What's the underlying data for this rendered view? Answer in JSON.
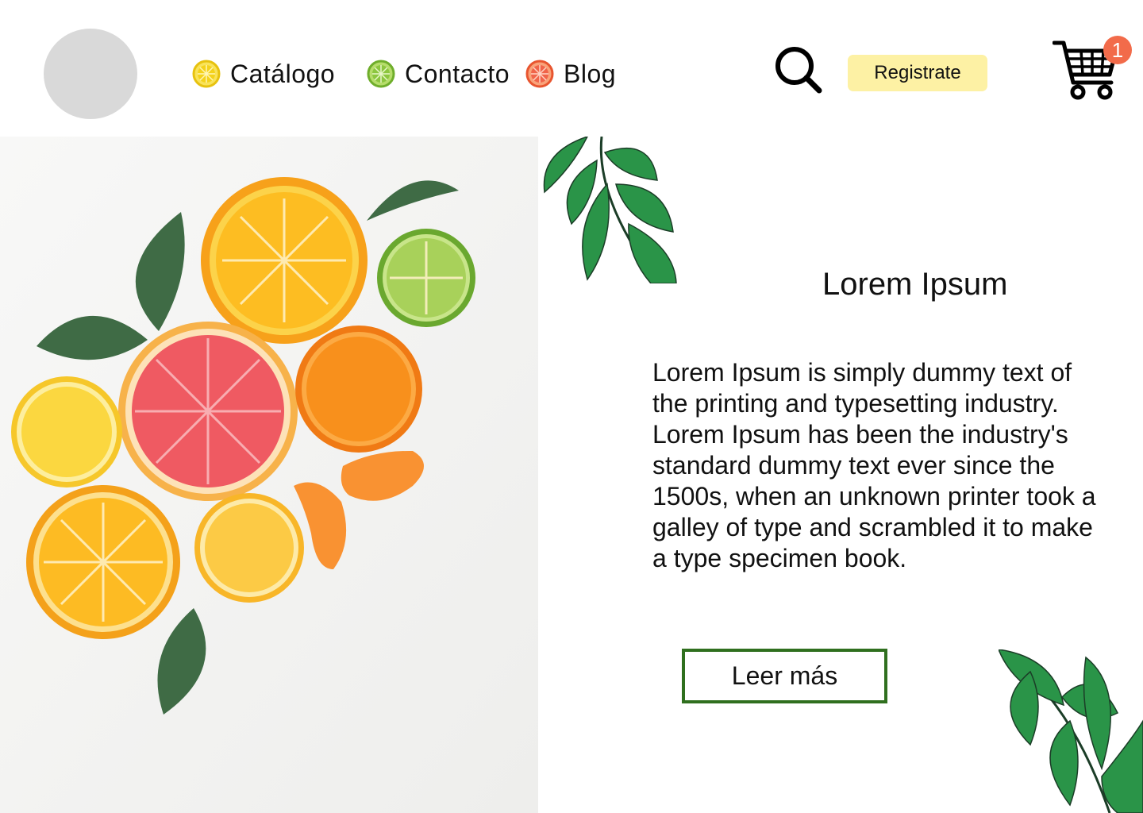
{
  "header": {
    "nav": [
      {
        "label": "Catálogo",
        "icon": "lemon-slice-icon",
        "color": "#f4d21c"
      },
      {
        "label": "Contacto",
        "icon": "lime-slice-icon",
        "color": "#8cc63f"
      },
      {
        "label": "Blog",
        "icon": "grapefruit-slice-icon",
        "color": "#f0644a"
      }
    ],
    "search_icon": "search-icon",
    "register_label": "Registrate",
    "cart_icon": "cart-icon",
    "cart_count": "1"
  },
  "main": {
    "title": "Lorem Ipsum",
    "body": "Lorem Ipsum is simply dummy text of the printing and typesetting industry. Lorem Ipsum has been the industry's standard dummy text ever since the 1500s, when an unknown printer took a galley of type and scrambled it to make a type specimen book.",
    "button_label": "Leer más"
  },
  "colors": {
    "register_bg": "#fdf1a4",
    "button_border": "#2f6f1e",
    "leaf_green": "#2a9448",
    "badge": "#f26b4a",
    "logo_placeholder": "#d9d9d9"
  }
}
